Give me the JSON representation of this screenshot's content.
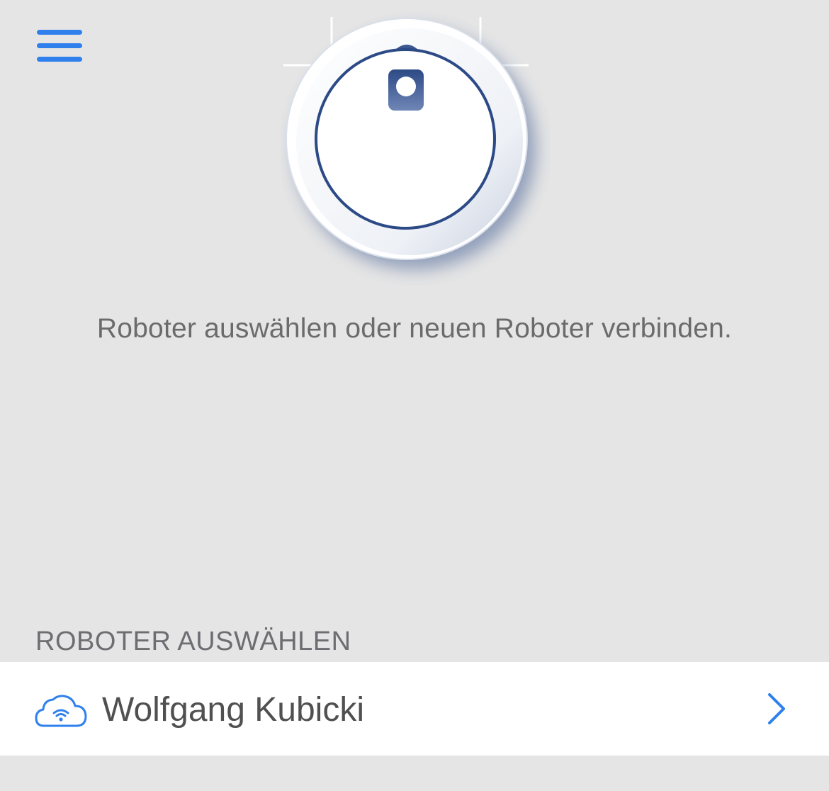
{
  "colors": {
    "accent": "#2f80ed",
    "background": "#e5e5e5",
    "row_background": "#ffffff",
    "robot_ring": "#2c4a86"
  },
  "header": {
    "menu_icon": "hamburger-menu-icon"
  },
  "illustration": {
    "icon": "robot-vacuum-illustration"
  },
  "main": {
    "instruction": "Roboter auswählen oder neuen Roboter verbinden."
  },
  "robot_list": {
    "section_title": "ROBOTER AUSWÄHLEN",
    "items": [
      {
        "name": "Wolfgang Kubicki",
        "status_icon": "cloud-wifi-icon",
        "action_icon": "chevron-right-icon"
      }
    ]
  }
}
